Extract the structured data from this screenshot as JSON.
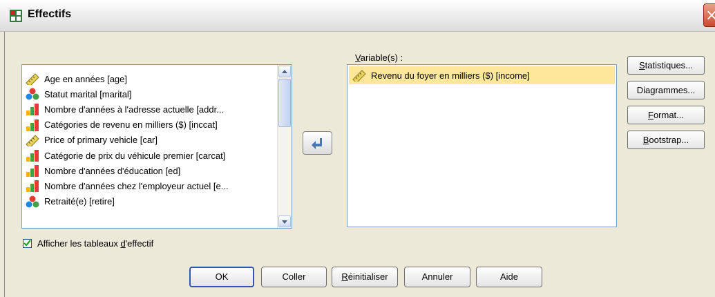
{
  "window": {
    "title": "Effectifs",
    "close_label": "×"
  },
  "source_list": {
    "items": [
      {
        "label": "Age en années [age]",
        "icon": "ruler-scale-icon"
      },
      {
        "label": "Statut marital [marital]",
        "icon": "nominal-circles-icon"
      },
      {
        "label": "Nombre d'années à l'adresse actuelle [addr...",
        "icon": "ordinal-bars-icon"
      },
      {
        "label": "Catégories de revenu en milliers ($) [inccat]",
        "icon": "ordinal-bars-icon"
      },
      {
        "label": "Price of primary vehicle [car]",
        "icon": "ruler-scale-icon"
      },
      {
        "label": "Catégorie de prix du véhicule premier [carcat]",
        "icon": "ordinal-bars-icon"
      },
      {
        "label": "Nombre d'années d'éducation [ed]",
        "icon": "ordinal-bars-icon"
      },
      {
        "label": "Nombre d'années chez l'employeur actuel [e...",
        "icon": "ordinal-bars-icon"
      },
      {
        "label": "Retraité(e) [retire]",
        "icon": "nominal-circles-icon"
      }
    ]
  },
  "target": {
    "label_underlined": "V",
    "label_rest": "ariable(s) :",
    "items": [
      {
        "label": "Revenu du foyer en milliers ($) [income]",
        "icon": "ruler-scale-icon"
      }
    ]
  },
  "side_buttons": [
    {
      "u": "S",
      "rest": "tatistiques..."
    },
    {
      "u": "",
      "rest": "Diagrammes..."
    },
    {
      "u": "F",
      "rest": "ormat..."
    },
    {
      "u": "B",
      "rest": "ootstrap..."
    }
  ],
  "checkbox": {
    "checked": true,
    "before": "Afficher les tableaux ",
    "u": "d",
    "after": "'effectif"
  },
  "bottom_buttons": [
    "OK",
    "Coller",
    "Réinitialiser",
    "Annuler",
    "Aide"
  ],
  "colors": {
    "selection": "#fde79a",
    "accent": "#2f59a8",
    "close": "#c94a2e"
  }
}
